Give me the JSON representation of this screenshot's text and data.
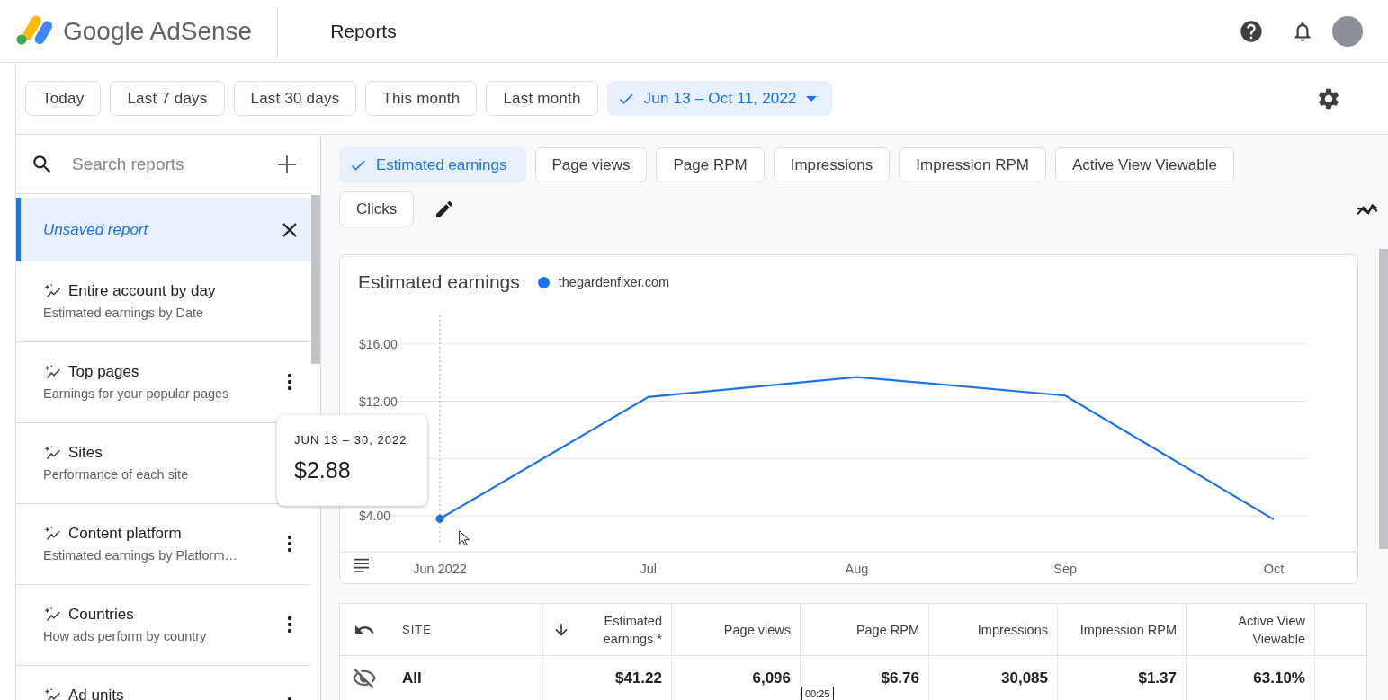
{
  "header": {
    "product": "Google AdSense",
    "page_title": "Reports"
  },
  "date_ranges": [
    {
      "label": "Today",
      "selected": false
    },
    {
      "label": "Last 7 days",
      "selected": false
    },
    {
      "label": "Last 30 days",
      "selected": false
    },
    {
      "label": "This month",
      "selected": false
    },
    {
      "label": "Last month",
      "selected": false
    },
    {
      "label": "Jun 13 – Oct 11, 2022",
      "selected": true
    }
  ],
  "sidebar": {
    "search": {
      "placeholder": "Search reports"
    },
    "items": [
      {
        "kind": "unsaved",
        "title": "Unsaved report",
        "selected": true
      },
      {
        "kind": "saved",
        "title": "Entire account by day",
        "subtitle": "Estimated earnings by Date",
        "selected": false,
        "menu": false
      },
      {
        "kind": "saved",
        "title": "Top pages",
        "subtitle": "Earnings for your popular pages",
        "selected": false,
        "menu": true
      },
      {
        "kind": "saved",
        "title": "Sites",
        "subtitle": "Performance of each site",
        "selected": false,
        "menu": false
      },
      {
        "kind": "saved",
        "title": "Content platform",
        "subtitle": "Estimated earnings by Platform…",
        "selected": false,
        "menu": true
      },
      {
        "kind": "saved",
        "title": "Countries",
        "subtitle": "How ads perform by country",
        "selected": false,
        "menu": true
      },
      {
        "kind": "saved",
        "title": "Ad units",
        "selected": false,
        "menu": true
      }
    ]
  },
  "metrics": [
    {
      "label": "Estimated earnings",
      "selected": true
    },
    {
      "label": "Page views",
      "selected": false
    },
    {
      "label": "Page RPM",
      "selected": false
    },
    {
      "label": "Impressions",
      "selected": false
    },
    {
      "label": "Impression RPM",
      "selected": false
    },
    {
      "label": "Active View Viewable",
      "selected": false
    },
    {
      "label": "Clicks",
      "selected": false
    }
  ],
  "chart": {
    "chart_data": {
      "type": "line",
      "title": "Estimated earnings",
      "categories": [
        "Jun 2022",
        "Jul",
        "Aug",
        "Sep",
        "Oct"
      ],
      "series": [
        {
          "name": "thegardenfixer.com",
          "color": "#1a73e8",
          "values": [
            3.8,
            12.3,
            13.7,
            12.4,
            3.75
          ]
        }
      ],
      "ylim": [
        2,
        18
      ],
      "grid": true,
      "ref_lines": [
        {
          "axis": "x",
          "value": "Jun 2022"
        }
      ],
      "yticks": [
        {
          "value": 4,
          "label": "$4.00"
        },
        {
          "value": 12,
          "label": "$12.00"
        },
        {
          "value": 16,
          "label": "$16.00"
        }
      ]
    }
  },
  "tooltip": {
    "date": "JUN 13 – 30, 2022",
    "value": "$2.88"
  },
  "table": {
    "columns": [
      {
        "label": "SITE",
        "sorted": false
      },
      {
        "label": "Estimated earnings *",
        "sorted": true
      },
      {
        "label": "Page views",
        "sorted": false
      },
      {
        "label": "Page RPM",
        "sorted": false
      },
      {
        "label": "Impressions",
        "sorted": false
      },
      {
        "label": "Impression RPM",
        "sorted": false
      },
      {
        "label": "Active View Viewable",
        "sorted": false
      }
    ],
    "rows": [
      {
        "hidden": true,
        "cells": [
          "All",
          "$41.22",
          "6,096",
          "$6.76",
          "30,085",
          "$1.37",
          "63.10%"
        ]
      }
    ]
  },
  "video_timestamp": "00:25"
}
